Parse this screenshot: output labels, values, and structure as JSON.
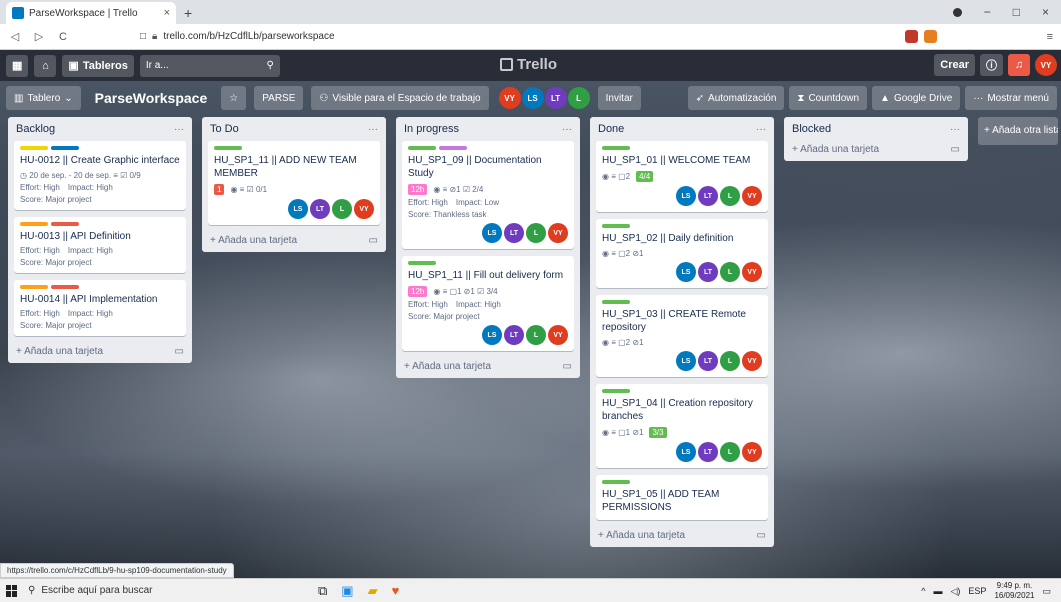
{
  "browser": {
    "tab_title": "ParseWorkspace | Trello",
    "tab_close": "×",
    "new_tab": "+",
    "url": "trello.com/b/HzCdflLb/parseworkspace",
    "back": "◁",
    "forward": "▷",
    "reload": "C",
    "min": "−",
    "max": "□",
    "close": "×"
  },
  "header": {
    "boards_label": "Tableros",
    "search_placeholder": "Ir a...",
    "logo_text": "Trello",
    "create_label": "Crear",
    "user_initials": "VY"
  },
  "board": {
    "view_label": "Tablero",
    "name": "ParseWorkspace",
    "workspace_label": "PARSE",
    "visibility_label": "Visible para el Espacio de trabajo",
    "members": [
      "VY",
      "LS",
      "LT",
      "L"
    ],
    "invite_label": "Invitar",
    "automation_label": "Automatización",
    "countdown_label": "Countdown",
    "drive_label": "Google Drive",
    "menu_label": "Mostrar menú",
    "add_list_label": "+ Añada otra lista"
  },
  "colors": {
    "label_yellow": "#f2d600",
    "label_blue": "#0079bf",
    "label_orange": "#ff9f1a",
    "label_red": "#eb5a46",
    "label_green": "#61bd4f",
    "label_purple": "#c377e0",
    "avatar_ls": "#0079bf",
    "avatar_lt": "#6f3bbf",
    "avatar_l": "#2f9e44",
    "avatar_vy": "#e03c1f"
  },
  "lists": [
    {
      "title": "Backlog",
      "add_label": "+ Añada una tarjeta",
      "cards": [
        {
          "labels": [
            "label_yellow",
            "label_blue"
          ],
          "title": "HU-0012 || Create Graphic interface",
          "badges": "◷ 20 de sep. - 20 de sep.   ≡   ☑ 0/9",
          "effort": "Effort: High",
          "impact": "Impact: High",
          "score": "Score: Major project",
          "members": []
        },
        {
          "labels": [
            "label_orange",
            "label_red"
          ],
          "title": "HU-0013 || API Definition",
          "badges": "",
          "effort": "Effort: High",
          "impact": "Impact: High",
          "score": "Score: Major project",
          "members": []
        },
        {
          "labels": [
            "label_orange",
            "label_red"
          ],
          "title": "HU-0014 || API Implementation",
          "badges": "",
          "effort": "Effort: High",
          "impact": "Impact: High",
          "score": "Score: Major project",
          "members": []
        }
      ]
    },
    {
      "title": "To Do",
      "add_label": "+ Añada una tarjeta",
      "cards": [
        {
          "labels": [
            "label_green"
          ],
          "title": "HU_SP1_11 || ADD NEW TEAM MEMBER",
          "badges": "◉  ≡  ☑ 0/1",
          "red_badge": "1",
          "effort": "",
          "impact": "",
          "score": "",
          "members": [
            "LS",
            "LT",
            "L",
            "VY"
          ]
        }
      ]
    },
    {
      "title": "In progress",
      "add_label": "+ Añada una tarjeta",
      "cards": [
        {
          "labels": [
            "label_green",
            "label_purple"
          ],
          "title": "HU_SP1_09 || Documentation Study",
          "badges": "◉  ≡  ⊘1  ☑ 2/4",
          "pink_badge": "12h",
          "effort": "Effort: High",
          "impact": "Impact: Low",
          "score": "Score: Thankless task",
          "members": [
            "LS",
            "LT",
            "L",
            "VY"
          ]
        },
        {
          "labels": [
            "label_green"
          ],
          "title": "HU_SP1_11 || Fill out delivery form",
          "badges": "◉  ≡  ▢1  ⊘1  ☑ 3/4",
          "pink_badge": "12h",
          "effort": "Effort: High",
          "impact": "Impact: High",
          "score": "Score: Major project",
          "members": [
            "LS",
            "LT",
            "L",
            "VY"
          ]
        }
      ]
    },
    {
      "title": "Done",
      "add_label": "+ Añada una tarjeta",
      "cards": [
        {
          "labels": [
            "label_green"
          ],
          "title": "HU_SP1_01 || WELCOME TEAM",
          "badges": "◉  ≡  ▢2",
          "green_badge": "4/4",
          "members": [
            "LS",
            "LT",
            "L",
            "VY"
          ]
        },
        {
          "labels": [
            "label_green"
          ],
          "title": "HU_SP1_02 || Daily definition",
          "badges": "◉  ≡  ▢2  ⊘1",
          "members": [
            "LS",
            "LT",
            "L",
            "VY"
          ]
        },
        {
          "labels": [
            "label_green"
          ],
          "title": "HU_SP1_03 || CREATE Remote repository",
          "badges": "◉  ≡  ▢2  ⊘1",
          "members": [
            "LS",
            "LT",
            "L",
            "VY"
          ]
        },
        {
          "labels": [
            "label_green"
          ],
          "title": "HU_SP1_04 || Creation repository branches",
          "badges": "◉  ≡  ▢1  ⊘1",
          "green_badge": "3/3",
          "members": [
            "LS",
            "LT",
            "L",
            "VY"
          ]
        },
        {
          "labels": [
            "label_green"
          ],
          "title": "HU_SP1_05 || ADD TEAM PERMISSIONS",
          "badges": "",
          "members": []
        }
      ]
    },
    {
      "title": "Blocked",
      "add_label": "+ Añada una tarjeta",
      "cards": []
    }
  ],
  "status_url": "https://trello.com/c/HzCdflLb/9-hu-sp109-documentation-study",
  "taskbar": {
    "search_placeholder": "Escribe aquí para buscar",
    "lang": "ESP",
    "time": "9:49 p. m.",
    "date": "16/09/2021"
  }
}
